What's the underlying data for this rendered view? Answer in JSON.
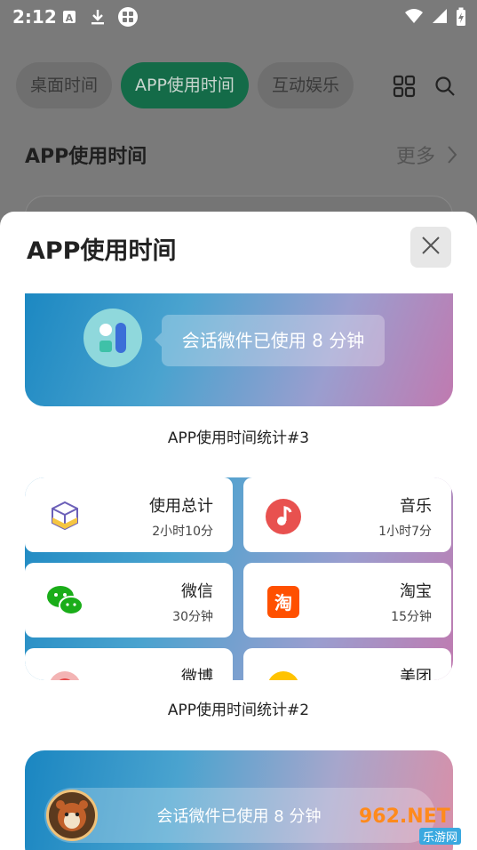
{
  "status_bar": {
    "time": "2:12",
    "icons": [
      "font-a-icon",
      "download-icon",
      "app-dots-icon",
      "wifi-icon",
      "signal-icon",
      "battery-charging-icon"
    ]
  },
  "background": {
    "tabs": [
      {
        "label": "桌面时间",
        "active": false
      },
      {
        "label": "APP使用时间",
        "active": true
      },
      {
        "label": "互动娱乐",
        "active": false
      }
    ],
    "section_title": "APP使用时间",
    "more_label": "更多"
  },
  "sheet": {
    "title": "APP使用时间",
    "widgets": [
      {
        "caption": "APP使用时间统计#3",
        "bubble_text": "会话微件已使用 8 分钟"
      },
      {
        "caption": "APP使用时间统计#2",
        "tiles": [
          {
            "name": "使用总计",
            "value": "2小时10分",
            "icon": "cube-icon"
          },
          {
            "name": "音乐",
            "value": "1小时7分",
            "icon": "music-icon"
          },
          {
            "name": "微信",
            "value": "30分钟",
            "icon": "wechat-icon"
          },
          {
            "name": "淘宝",
            "value": "15分钟",
            "icon": "taobao-icon"
          },
          {
            "name": "微博",
            "value": "",
            "icon": "weibo-icon"
          },
          {
            "name": "美团",
            "value": "",
            "icon": "meituan-icon"
          }
        ]
      },
      {
        "bar_text": "会话微件已使用 8 分钟"
      }
    ]
  },
  "watermark": {
    "brand": "962.NET",
    "sub": "乐游网"
  },
  "colors": {
    "accent_green": "#146b48",
    "gradient_start": "#1c88c2",
    "gradient_end": "#c07ab0"
  }
}
